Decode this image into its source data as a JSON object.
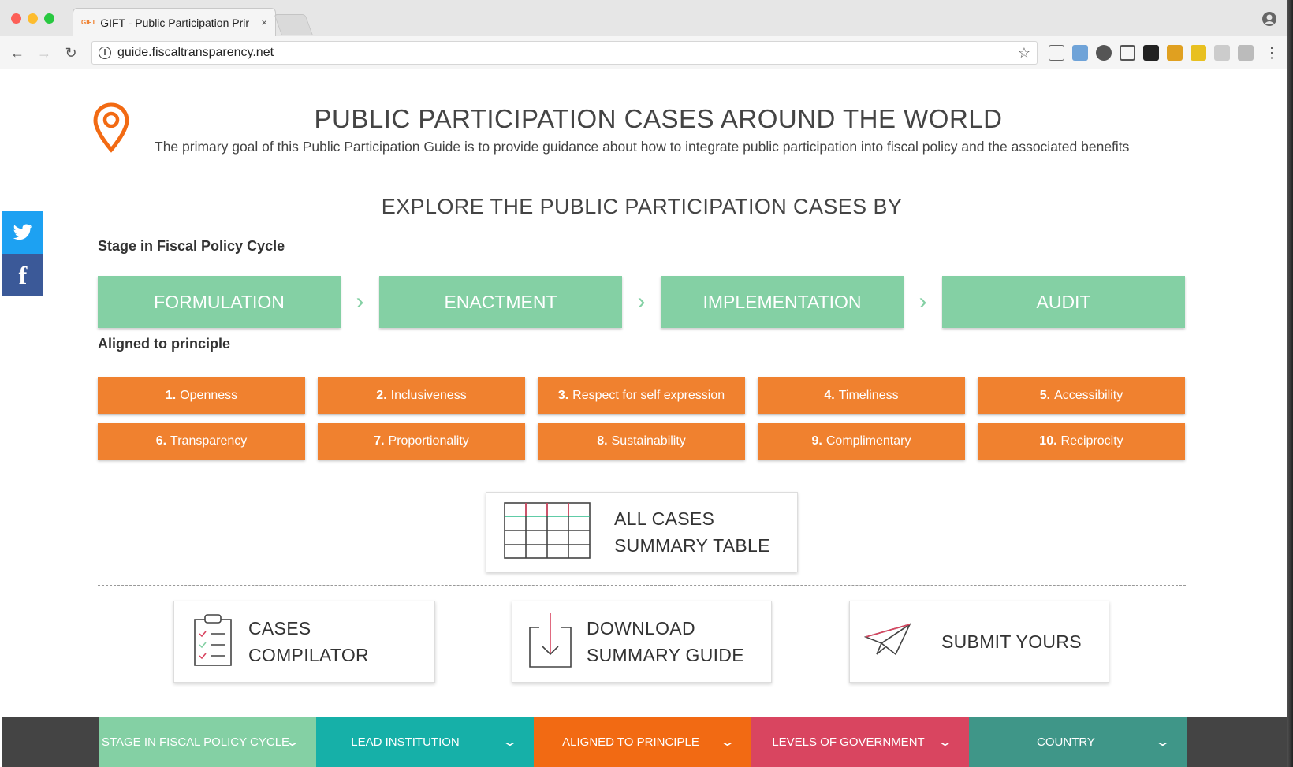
{
  "browser": {
    "tab_title": "GIFT - Public Participation Prir",
    "tab_favicon": "GIFT",
    "tab_close": "×",
    "url": "guide.fiscaltransparency.net"
  },
  "header": {
    "title": "PUBLIC PARTICIPATION CASES AROUND THE WORLD",
    "subtitle": "The primary goal of this Public Participation Guide is to provide guidance about how to integrate public participation into fiscal policy and the associated benefits"
  },
  "explore": {
    "heading": "EXPLORE THE PUBLIC PARTICIPATION CASES BY"
  },
  "stage_section": {
    "label": "Stage in Fiscal Policy Cycle",
    "stages": [
      "FORMULATION",
      "ENACTMENT",
      "IMPLEMENTATION",
      "AUDIT"
    ]
  },
  "principle_section": {
    "label": "Aligned to principle",
    "principles": [
      {
        "num": "1.",
        "name": "Openness"
      },
      {
        "num": "2.",
        "name": "Inclusiveness"
      },
      {
        "num": "3.",
        "name": "Respect for self expression"
      },
      {
        "num": "4.",
        "name": "Timeliness"
      },
      {
        "num": "5.",
        "name": "Accessibility"
      },
      {
        "num": "6.",
        "name": "Transparency"
      },
      {
        "num": "7.",
        "name": "Proportionality"
      },
      {
        "num": "8.",
        "name": "Sustainability"
      },
      {
        "num": "9.",
        "name": "Complimentary"
      },
      {
        "num": "10.",
        "name": "Reciprocity"
      }
    ]
  },
  "cards": {
    "summary_table": {
      "line1": "ALL CASES",
      "line2": "SUMMARY TABLE"
    },
    "compilator": {
      "line1": "CASES",
      "line2": "COMPILATOR"
    },
    "download": {
      "line1": "DOWNLOAD",
      "line2": "SUMMARY GUIDE"
    },
    "submit": {
      "line1": "SUBMIT YOURS"
    }
  },
  "filter_bar": {
    "items": [
      {
        "label": "STAGE IN FISCAL POLICY CYCLE",
        "color": "#84d0a4"
      },
      {
        "label": "LEAD INSTITUTION",
        "color": "#16b0a8"
      },
      {
        "label": "ALIGNED TO PRINCIPLE",
        "color": "#f26a13"
      },
      {
        "label": "LEVELS OF GOVERNMENT",
        "color": "#d94560"
      },
      {
        "label": "COUNTRY",
        "color": "#3f9688"
      }
    ]
  },
  "colors": {
    "stage_green": "#84d0a4",
    "principle_orange": "#f0812f",
    "twitter_blue": "#1da1f2",
    "facebook_blue": "#3b5998"
  }
}
